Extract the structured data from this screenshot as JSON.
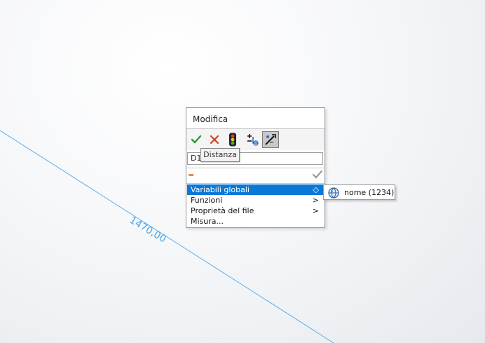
{
  "dialog": {
    "title": "Modifica",
    "toolbar": {
      "ok_icon": "checkmark-icon",
      "cancel_icon": "close-icon",
      "rebuild_icon": "traffic-light-icon",
      "reverse_icon": "reverse-dimension-icon",
      "mark_icon": "dimension-marker-icon"
    },
    "name_value": "D1",
    "expression_value": "=",
    "menu": {
      "items": [
        {
          "label": "Variabili globali",
          "arrow": "◇"
        },
        {
          "label": "Funzioni",
          "arrow": ">"
        },
        {
          "label": "Proprietà del file",
          "arrow": ">"
        },
        {
          "label": "Misura...",
          "arrow": ""
        }
      ]
    }
  },
  "tooltip": "Distanza",
  "submenu": {
    "label": "nome (1234)",
    "icon": "globe-icon"
  },
  "dimension": {
    "value": "1470,00",
    "color": "#4aa6ea"
  }
}
